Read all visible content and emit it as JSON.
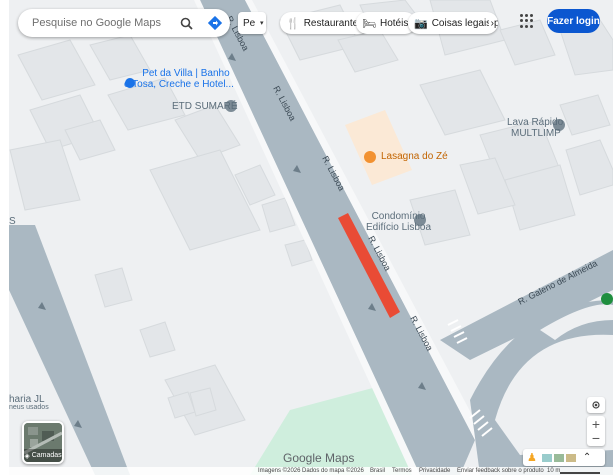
{
  "search": {
    "placeholder": "Pesquise no Google Maps"
  },
  "directions_chip": {
    "label": "Pe"
  },
  "chips": [
    {
      "label": "Restaurantes",
      "icon": "fork-knife-icon"
    },
    {
      "label": "Hotéis",
      "icon": "bed-icon"
    },
    {
      "label": "Coisas legais p",
      "icon": "camera-icon"
    }
  ],
  "header": {
    "login_label": "Fazer login"
  },
  "map": {
    "streets": [
      {
        "name": "R. Lisboa"
      },
      {
        "name": "R. Lisboa"
      },
      {
        "name": "R. Lisboa"
      },
      {
        "name": "R. Lisboa"
      },
      {
        "name": "R. Galeno de Almeida"
      }
    ],
    "pois": [
      {
        "name": "Pet da Villa | Banho",
        "line2": "e Tosa, Creche e Hotel..."
      },
      {
        "name": "ETD SUMARÉ"
      },
      {
        "name": "Lasagna do Zé"
      },
      {
        "name": "Lava Rápido",
        "line2": "MULTLIMP"
      },
      {
        "name": "Condomínio",
        "line2": "Edifício Lisboa"
      }
    ],
    "edge_labels": {
      "left_s": "S",
      "left_haria": "haria JL",
      "left_vistos": "neus usados"
    },
    "traffic_color": "#e94b35",
    "road_color": "#aab8c2"
  },
  "layers": {
    "label": "Camadas"
  },
  "logo": {
    "text": "Google Maps"
  },
  "footer": {
    "imagery": "Imagens ©2026",
    "map_data": "Dados do mapa ©2026",
    "country": "Brasil",
    "terms": "Termos",
    "privacy": "Privacidade",
    "feedback": "Enviar feedback sobre o produto",
    "scale": "10 m"
  }
}
